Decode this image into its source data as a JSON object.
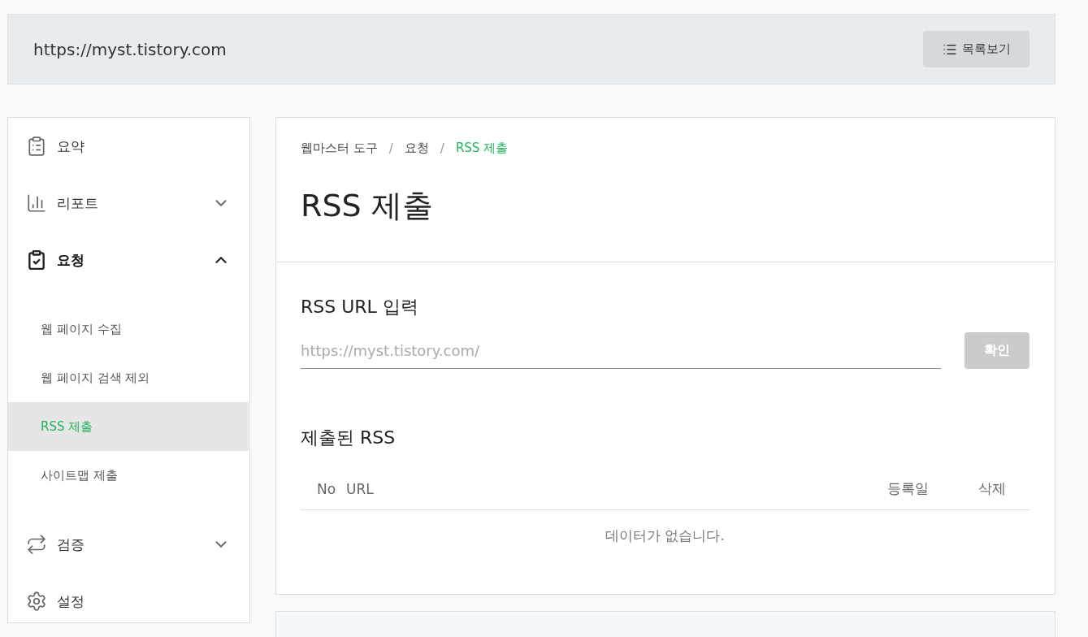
{
  "header": {
    "url": "https://myst.tistory.com",
    "list_button": "목록보기"
  },
  "sidebar": {
    "items": [
      {
        "label": "요약",
        "kind": "link",
        "selected": false
      },
      {
        "label": "리포트",
        "kind": "group",
        "selected": false,
        "expanded": false
      },
      {
        "label": "요청",
        "kind": "group",
        "selected": true,
        "expanded": true,
        "children": [
          {
            "label": "웹 페이지 수집",
            "selected": false
          },
          {
            "label": "웹 페이지 검색 제외",
            "selected": false
          },
          {
            "label": "RSS 제출",
            "selected": true
          },
          {
            "label": "사이트맵 제출",
            "selected": false
          }
        ]
      },
      {
        "label": "검증",
        "kind": "group",
        "selected": false,
        "expanded": false
      },
      {
        "label": "설정",
        "kind": "link",
        "selected": false
      }
    ]
  },
  "breadcrumb": [
    {
      "label": "웹마스터 도구",
      "selected": false
    },
    {
      "separator": "/",
      "label": "요청",
      "selected": false
    },
    {
      "separator": "/",
      "label": "RSS 제출",
      "selected": true
    }
  ],
  "page_title": "RSS 제출",
  "form": {
    "label": "RSS URL 입력",
    "placeholder": "https://myst.tistory.com/",
    "submit": "확인"
  },
  "submitted": {
    "title": "제출된 RSS",
    "columns": [
      "No",
      "URL",
      "등록일",
      "삭제"
    ],
    "empty": "데이터가 없습니다."
  }
}
